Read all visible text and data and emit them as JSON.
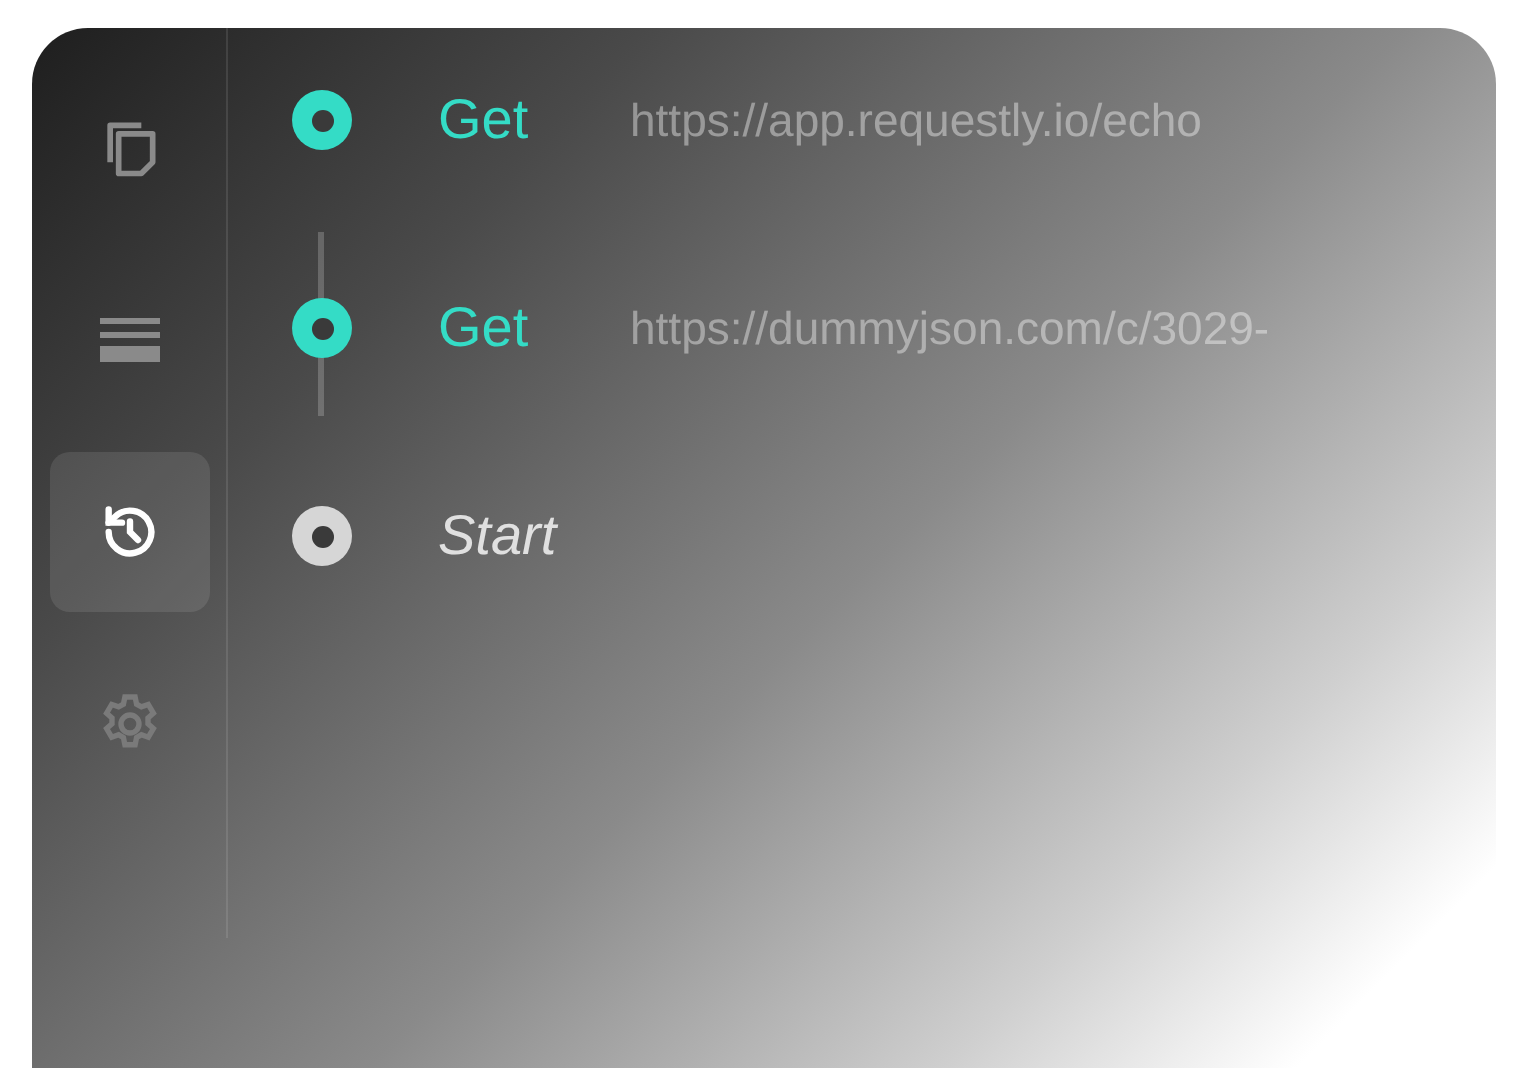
{
  "sidebar": {
    "items": [
      {
        "kind": "copy",
        "selected": false
      },
      {
        "kind": "list",
        "selected": false
      },
      {
        "kind": "history",
        "selected": true
      },
      {
        "kind": "settings",
        "selected": false
      }
    ]
  },
  "history": [
    {
      "kind": "request",
      "method": "Get",
      "url": "https://app.requestly.io/echo"
    },
    {
      "kind": "request",
      "method": "Get",
      "url": "https://dummyjson.com/c/3029-"
    },
    {
      "kind": "start",
      "label": "Start"
    }
  ]
}
